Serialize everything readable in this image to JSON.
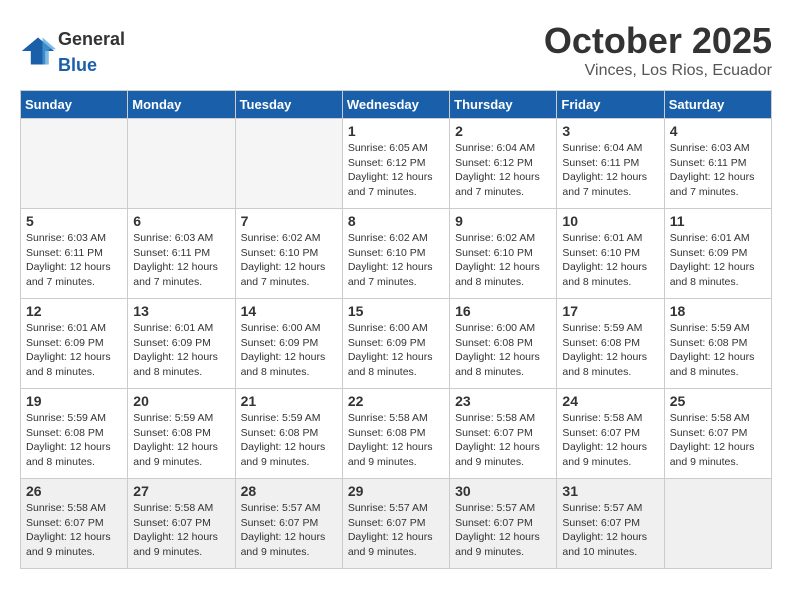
{
  "header": {
    "logo_general": "General",
    "logo_blue": "Blue",
    "month_title": "October 2025",
    "location": "Vinces, Los Rios, Ecuador"
  },
  "weekdays": [
    "Sunday",
    "Monday",
    "Tuesday",
    "Wednesday",
    "Thursday",
    "Friday",
    "Saturday"
  ],
  "weeks": [
    [
      {
        "day": "",
        "info": ""
      },
      {
        "day": "",
        "info": ""
      },
      {
        "day": "",
        "info": ""
      },
      {
        "day": "1",
        "info": "Sunrise: 6:05 AM\nSunset: 6:12 PM\nDaylight: 12 hours\nand 7 minutes."
      },
      {
        "day": "2",
        "info": "Sunrise: 6:04 AM\nSunset: 6:12 PM\nDaylight: 12 hours\nand 7 minutes."
      },
      {
        "day": "3",
        "info": "Sunrise: 6:04 AM\nSunset: 6:11 PM\nDaylight: 12 hours\nand 7 minutes."
      },
      {
        "day": "4",
        "info": "Sunrise: 6:03 AM\nSunset: 6:11 PM\nDaylight: 12 hours\nand 7 minutes."
      }
    ],
    [
      {
        "day": "5",
        "info": "Sunrise: 6:03 AM\nSunset: 6:11 PM\nDaylight: 12 hours\nand 7 minutes."
      },
      {
        "day": "6",
        "info": "Sunrise: 6:03 AM\nSunset: 6:11 PM\nDaylight: 12 hours\nand 7 minutes."
      },
      {
        "day": "7",
        "info": "Sunrise: 6:02 AM\nSunset: 6:10 PM\nDaylight: 12 hours\nand 7 minutes."
      },
      {
        "day": "8",
        "info": "Sunrise: 6:02 AM\nSunset: 6:10 PM\nDaylight: 12 hours\nand 7 minutes."
      },
      {
        "day": "9",
        "info": "Sunrise: 6:02 AM\nSunset: 6:10 PM\nDaylight: 12 hours\nand 8 minutes."
      },
      {
        "day": "10",
        "info": "Sunrise: 6:01 AM\nSunset: 6:10 PM\nDaylight: 12 hours\nand 8 minutes."
      },
      {
        "day": "11",
        "info": "Sunrise: 6:01 AM\nSunset: 6:09 PM\nDaylight: 12 hours\nand 8 minutes."
      }
    ],
    [
      {
        "day": "12",
        "info": "Sunrise: 6:01 AM\nSunset: 6:09 PM\nDaylight: 12 hours\nand 8 minutes."
      },
      {
        "day": "13",
        "info": "Sunrise: 6:01 AM\nSunset: 6:09 PM\nDaylight: 12 hours\nand 8 minutes."
      },
      {
        "day": "14",
        "info": "Sunrise: 6:00 AM\nSunset: 6:09 PM\nDaylight: 12 hours\nand 8 minutes."
      },
      {
        "day": "15",
        "info": "Sunrise: 6:00 AM\nSunset: 6:09 PM\nDaylight: 12 hours\nand 8 minutes."
      },
      {
        "day": "16",
        "info": "Sunrise: 6:00 AM\nSunset: 6:08 PM\nDaylight: 12 hours\nand 8 minutes."
      },
      {
        "day": "17",
        "info": "Sunrise: 5:59 AM\nSunset: 6:08 PM\nDaylight: 12 hours\nand 8 minutes."
      },
      {
        "day": "18",
        "info": "Sunrise: 5:59 AM\nSunset: 6:08 PM\nDaylight: 12 hours\nand 8 minutes."
      }
    ],
    [
      {
        "day": "19",
        "info": "Sunrise: 5:59 AM\nSunset: 6:08 PM\nDaylight: 12 hours\nand 8 minutes."
      },
      {
        "day": "20",
        "info": "Sunrise: 5:59 AM\nSunset: 6:08 PM\nDaylight: 12 hours\nand 9 minutes."
      },
      {
        "day": "21",
        "info": "Sunrise: 5:59 AM\nSunset: 6:08 PM\nDaylight: 12 hours\nand 9 minutes."
      },
      {
        "day": "22",
        "info": "Sunrise: 5:58 AM\nSunset: 6:08 PM\nDaylight: 12 hours\nand 9 minutes."
      },
      {
        "day": "23",
        "info": "Sunrise: 5:58 AM\nSunset: 6:07 PM\nDaylight: 12 hours\nand 9 minutes."
      },
      {
        "day": "24",
        "info": "Sunrise: 5:58 AM\nSunset: 6:07 PM\nDaylight: 12 hours\nand 9 minutes."
      },
      {
        "day": "25",
        "info": "Sunrise: 5:58 AM\nSunset: 6:07 PM\nDaylight: 12 hours\nand 9 minutes."
      }
    ],
    [
      {
        "day": "26",
        "info": "Sunrise: 5:58 AM\nSunset: 6:07 PM\nDaylight: 12 hours\nand 9 minutes."
      },
      {
        "day": "27",
        "info": "Sunrise: 5:58 AM\nSunset: 6:07 PM\nDaylight: 12 hours\nand 9 minutes."
      },
      {
        "day": "28",
        "info": "Sunrise: 5:57 AM\nSunset: 6:07 PM\nDaylight: 12 hours\nand 9 minutes."
      },
      {
        "day": "29",
        "info": "Sunrise: 5:57 AM\nSunset: 6:07 PM\nDaylight: 12 hours\nand 9 minutes."
      },
      {
        "day": "30",
        "info": "Sunrise: 5:57 AM\nSunset: 6:07 PM\nDaylight: 12 hours\nand 9 minutes."
      },
      {
        "day": "31",
        "info": "Sunrise: 5:57 AM\nSunset: 6:07 PM\nDaylight: 12 hours\nand 10 minutes."
      },
      {
        "day": "",
        "info": ""
      }
    ]
  ]
}
